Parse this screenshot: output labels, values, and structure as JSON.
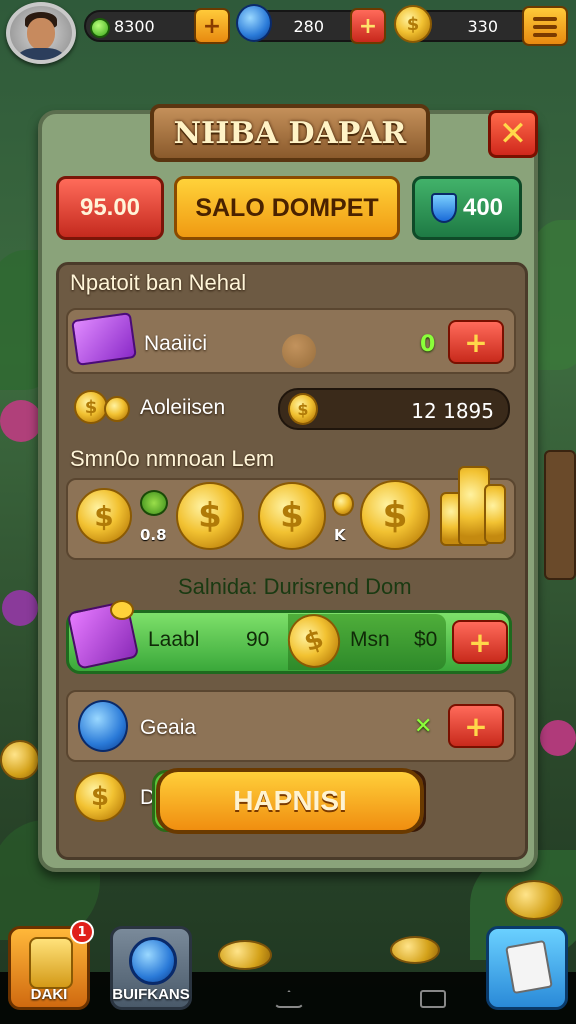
{
  "hud": {
    "gems_value": "8300",
    "energy_value": "280",
    "coins_value": "330"
  },
  "panel": {
    "title": "NHBA DAPAR",
    "close_symbol": "✕",
    "red_value": "95.00",
    "main_button": "SALO DOMPET",
    "shield_value": "400"
  },
  "section1": {
    "title": "Npatoit ban Nehal",
    "row1_label": "Naaiici",
    "row1_value": "0",
    "row2_label": "Aoleiisen",
    "row2_amount": "12 1895"
  },
  "section2": {
    "title": "Smn0o nmnoan Lem",
    "label_a": "0.8",
    "label_b": "K"
  },
  "section3": {
    "title": "Salnida: Durisrend Dom",
    "land_label": "Laabl",
    "land_value": "90",
    "msn_label": "Msn",
    "msn_value": "$0",
    "geaia_label": "Geaia",
    "geaia_value": "✕",
    "partial_label": "D",
    "action_button": "HAPNISI"
  },
  "bottom": {
    "left_label": "DAKI",
    "left_badge": "1",
    "right_label": "BUIFKANS"
  },
  "colors": {
    "gold": "#f2c232",
    "red": "#c82a1c",
    "green": "#3aa83a"
  }
}
